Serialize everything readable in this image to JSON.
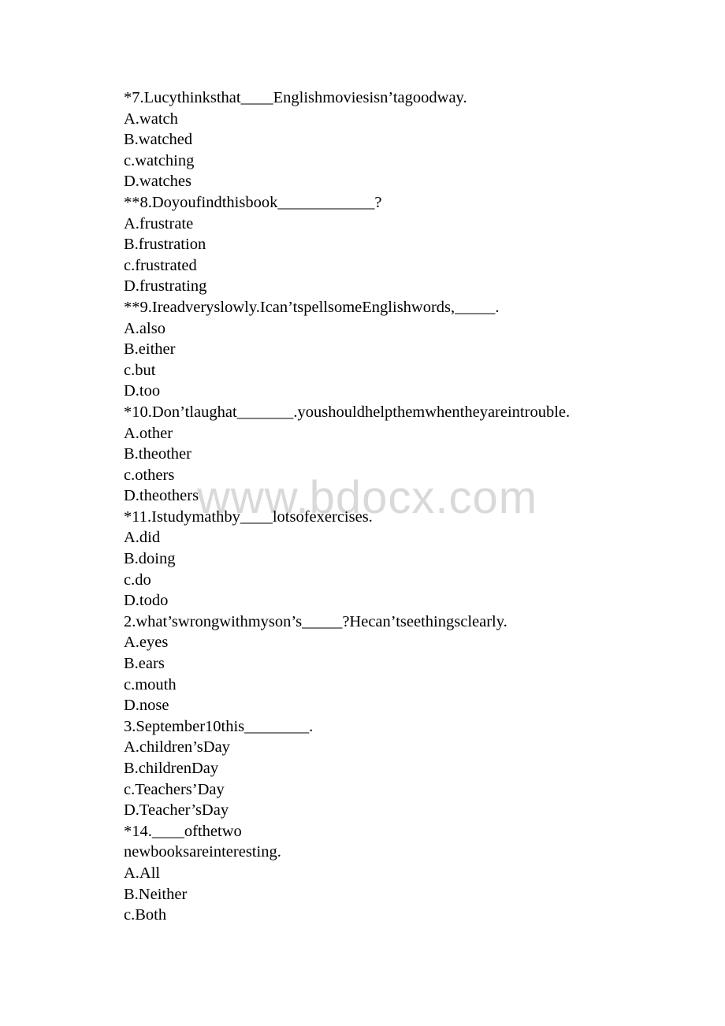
{
  "document": {
    "watermark": "www.bdocx.com",
    "questions": [
      {
        "stem": "*7.Lucythinksthat____Englishmoviesisn’tagoodway.",
        "options": [
          "A.watch",
          "B.watched",
          "c.watching",
          "D.watches"
        ]
      },
      {
        "stem": "**8.Doyoufindthisbook____________?",
        "options": [
          "A.frustrate",
          "B.frustration",
          "c.frustrated",
          "D.frustrating"
        ]
      },
      {
        "stem": "**9.Ireadveryslowly.Ican’tspellsomeEnglishwords,_____.",
        "options": [
          "A.also",
          "B.either",
          "c.but",
          "D.too"
        ]
      },
      {
        "stem": "*10.Don’tlaughat_______.youshouldhelpthemwhentheyareintrouble.",
        "options": [
          "A.other",
          "B.theother",
          "c.others",
          "D.theothers"
        ]
      },
      {
        "stem": "*11.Istudymathby____lotsofexercises.",
        "options": [
          "A.did",
          "B.doing",
          "c.do",
          "D.todo"
        ]
      },
      {
        "stem": "2.what’swrongwithmyson’s_____?Hecan’tseethingsclearly.",
        "options": [
          "A.eyes",
          "B.ears",
          "c.mouth",
          "D.nose"
        ]
      },
      {
        "stem": "3.September10this________.",
        "options": [
          "A.children’sDay",
          "B.childrenDay",
          "c.Teachers’Day",
          "D.Teacher’sDay"
        ]
      },
      {
        "stem": "*14.____ofthetwo",
        "stem_continued": "newbooksareinteresting.",
        "options": [
          "A.All",
          "B.Neither",
          "c.Both"
        ]
      }
    ]
  }
}
